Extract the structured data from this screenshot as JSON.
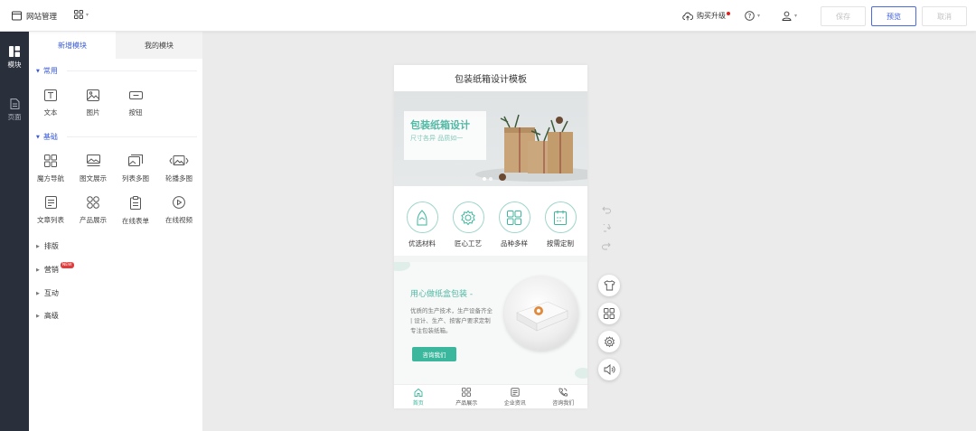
{
  "header": {
    "site_title": "网站管理",
    "buy_label": "购买升级",
    "save_label": "保存",
    "preview_label": "预览",
    "cancel_label": "取消"
  },
  "left_nav": [
    {
      "label": "模块",
      "icon": "modules-icon",
      "active": true
    },
    {
      "label": "页面",
      "icon": "page-icon",
      "active": false
    }
  ],
  "panel": {
    "tabs": [
      "新增模块",
      "我的模块"
    ],
    "sections": {
      "common": {
        "title": "常用",
        "items": [
          "文本",
          "图片",
          "按钮"
        ]
      },
      "basic": {
        "title": "基础",
        "items": [
          "魔方导航",
          "图文展示",
          "列表多图",
          "轮播多图",
          "文章列表",
          "产品展示",
          "在线表单",
          "在线视频"
        ]
      }
    },
    "collapsed": [
      "排版",
      "营销",
      "互动",
      "高级"
    ],
    "new_badge": "NEW"
  },
  "phone": {
    "title": "包装纸箱设计模板",
    "banner": {
      "headline": "包装纸箱设计",
      "sub": "尺寸各异 品质如一"
    },
    "features": [
      "优选材料",
      "匠心工艺",
      "品种多样",
      "按需定制"
    ],
    "promo": {
      "heading": "用心做纸盒包装 -",
      "text": "优质的生产技术，生产设备齐全 | 设计、生产、按客户要求定制专注包装纸箱。",
      "cta": "咨询我们"
    },
    "bottom_nav": [
      "首页",
      "产品展示",
      "企业资讯",
      "咨询我们"
    ]
  },
  "colors": {
    "accent": "#3a5bd9",
    "brand_green": "#3bb79d",
    "sidebar_dark": "#2a2f3c"
  }
}
